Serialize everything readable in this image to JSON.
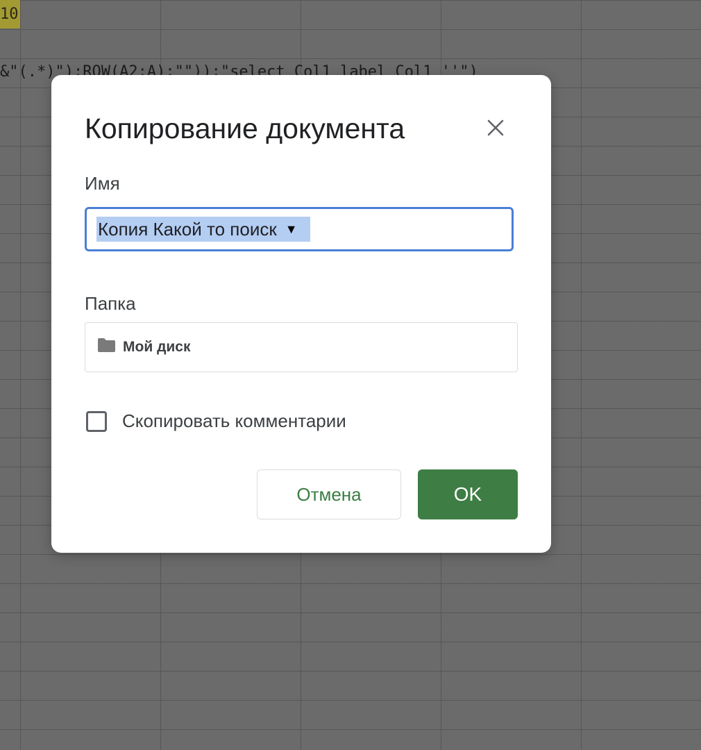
{
  "background": {
    "cell_text": "10",
    "formula_text": "&\"(.*)\"):ROW(A2:A);\"\"));\"select Col1 label Col1 ''\")"
  },
  "dialog": {
    "title": "Копирование документа",
    "close_icon": "close-icon",
    "name_label": "Имя",
    "name_value": "Копия Какой то поиск",
    "name_caret": "▼",
    "folder_label": "Папка",
    "folder_icon": "folder-icon",
    "folder_value": "Мой диск",
    "copy_comments_label": "Скопировать комментарии",
    "copy_comments_checked": false,
    "cancel_label": "Отмена",
    "ok_label": "OK"
  },
  "colors": {
    "accent_blue": "#4a7fd6",
    "selection": "#b4cdf3",
    "ok_green": "#3e7d44",
    "cancel_text_green": "#3b7d43"
  }
}
